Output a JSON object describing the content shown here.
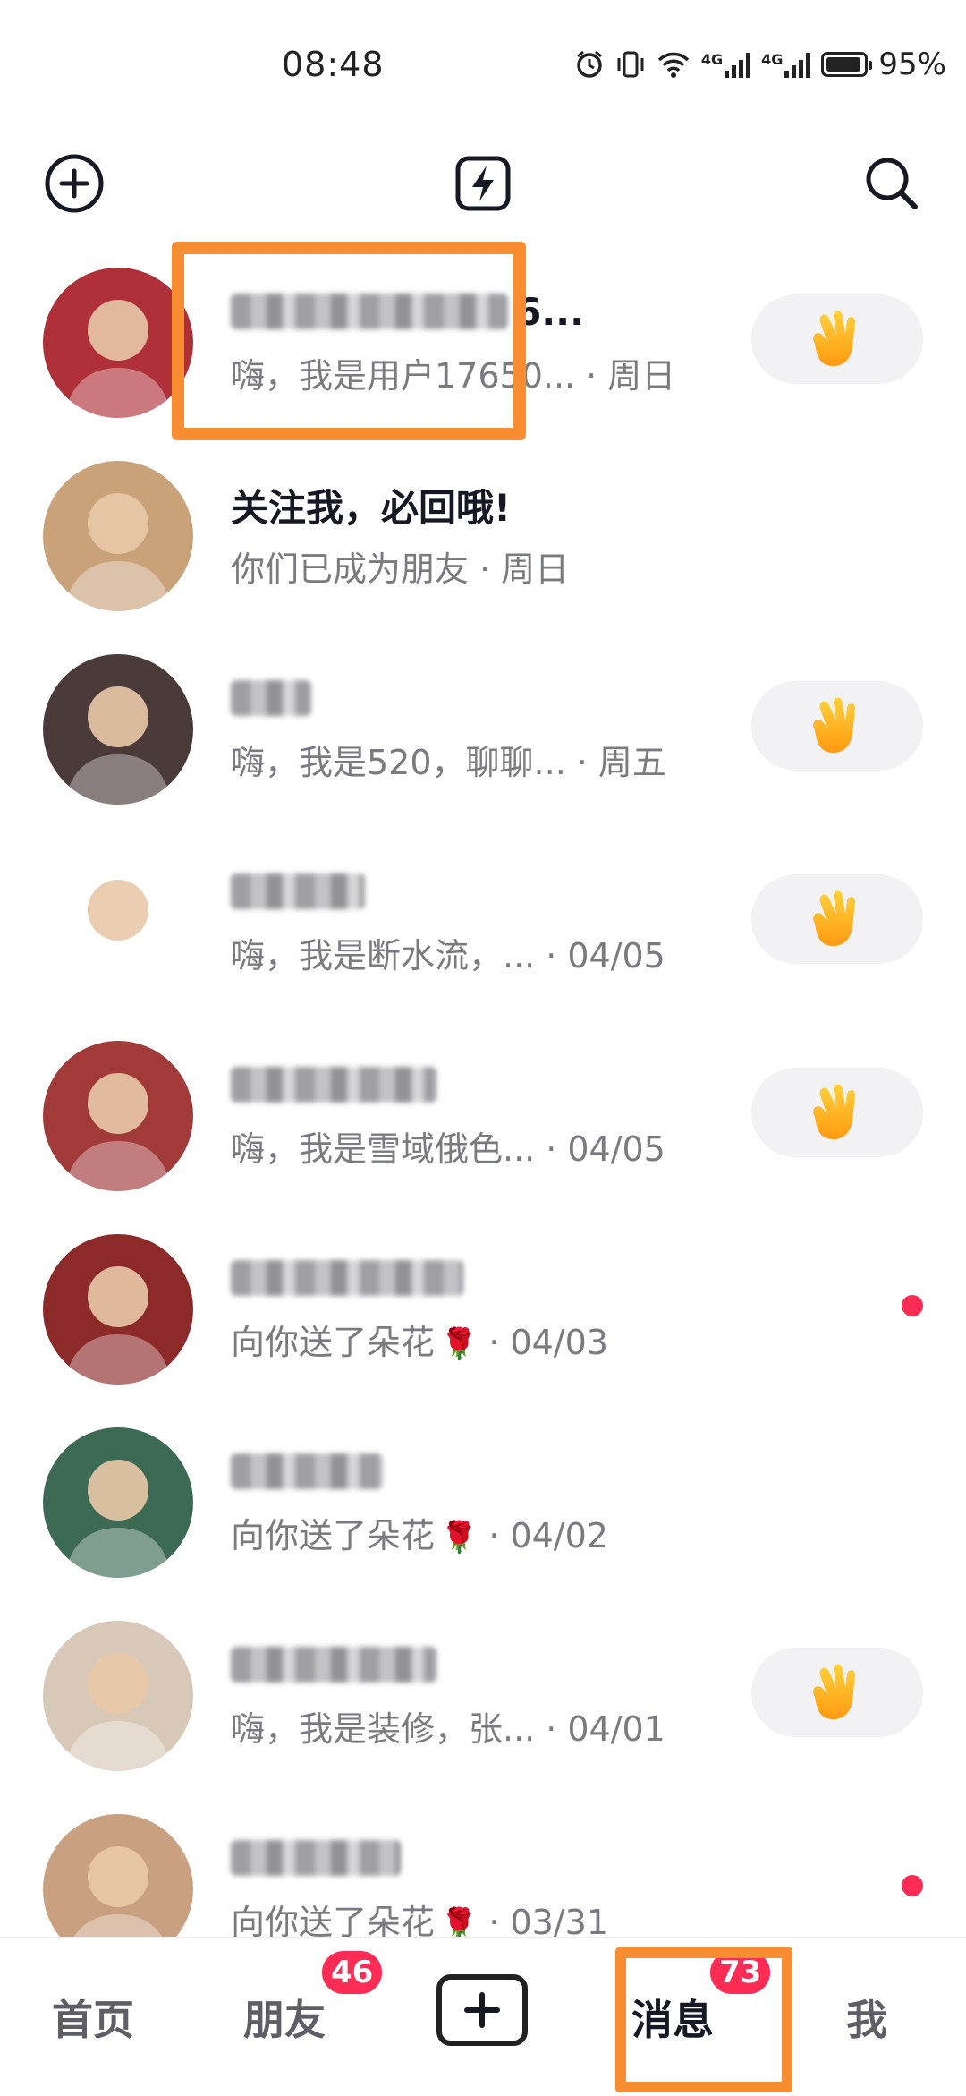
{
  "status_bar": {
    "time": "08:48",
    "battery_text": "95%",
    "battery_level": 0.95,
    "net_label_1": "4G",
    "net_label_2": "4G"
  },
  "top_nav": {
    "left_icon": "add-circle-icon",
    "center_icon": "lightning-icon",
    "right_icon": "search-icon"
  },
  "conversations": [
    {
      "name": "",
      "name_suffix": "6...",
      "preview": "嗨，我是用户17650...",
      "date": "周日",
      "action": "wave-hand-icon",
      "avatar_color": "#b0303a"
    },
    {
      "name": "关注我，必回哦!",
      "name_suffix": "",
      "preview": "你们已成为朋友",
      "date": "周日",
      "action": "",
      "avatar_color": "#caa27a"
    },
    {
      "name": "",
      "name_suffix": "",
      "preview": "嗨，我是520，聊聊...",
      "date": "周五",
      "action": "wave-hand-icon",
      "avatar_color": "#4a3a3a"
    },
    {
      "name": "",
      "name_suffix": "",
      "preview": "嗨，我是断水流，...",
      "date": "04/05",
      "action": "wave-hand-icon",
      "avatar_color": "#ffffff"
    },
    {
      "name": "",
      "name_suffix": "",
      "preview": "嗨，我是雪域俄色...",
      "date": "04/05",
      "action": "wave-hand-icon",
      "avatar_color": "#a23a3a"
    },
    {
      "name": "",
      "name_suffix": "",
      "preview": "向你送了朵花",
      "rose": "🌹",
      "date": "04/03",
      "action": "unread-dot",
      "avatar_color": "#8c2a2a"
    },
    {
      "name": "",
      "name_suffix": "",
      "preview": "向你送了朵花",
      "rose": "🌹",
      "date": "04/02",
      "action": "",
      "avatar_color": "#3d6a55"
    },
    {
      "name": "",
      "name_suffix": "",
      "preview": "嗨，我是装修，张...",
      "date": "04/01",
      "action": "wave-hand-icon",
      "avatar_color": "#d8c8b8"
    },
    {
      "name": "",
      "name_suffix": "",
      "preview": "向你送了朵花",
      "rose": "🌹",
      "date": "03/31",
      "action": "unread-dot",
      "avatar_color": "#c9a080"
    }
  ],
  "tabs": {
    "home": "首页",
    "friends": "朋友",
    "friends_badge": "46",
    "create": "plus-icon",
    "messages": "消息",
    "messages_badge": "73",
    "me": "我"
  },
  "colors": {
    "accent": "#fe2c55",
    "highlight": "#f88d31"
  }
}
